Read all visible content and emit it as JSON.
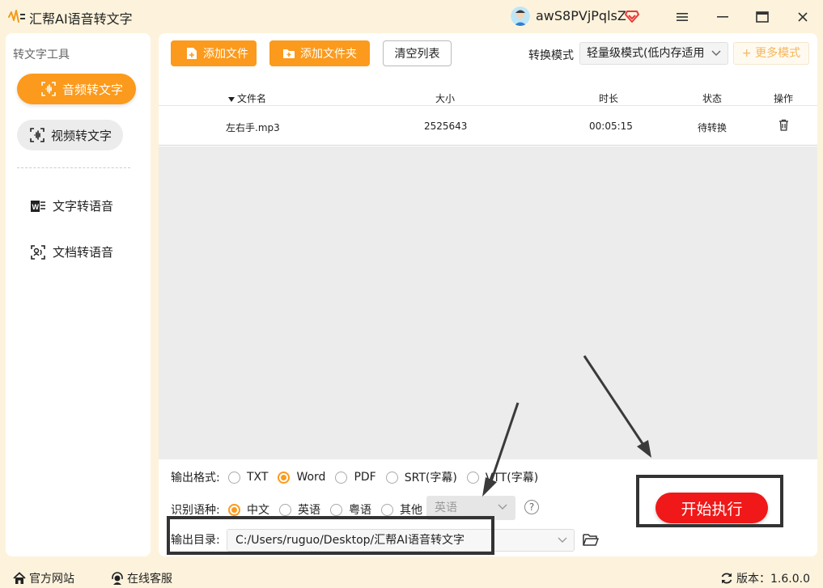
{
  "app": {
    "title": "汇帮AI语音转文字",
    "username": "awS8PVjPqlsZ"
  },
  "sidebar": {
    "title": "转文字工具",
    "items": [
      {
        "label": "音频转文字",
        "active": true,
        "icon": "audio-wave-icon"
      },
      {
        "label": "视频转文字",
        "active": false,
        "icon": "video-wave-icon"
      },
      {
        "label": "文字转语音",
        "active": false,
        "icon": "word-doc-icon"
      },
      {
        "label": "文档转语音",
        "active": false,
        "icon": "doc-voice-icon"
      }
    ]
  },
  "toolbar": {
    "add_file": "添加文件",
    "add_folder": "添加文件夹",
    "clear_list": "清空列表",
    "mode_label": "转换模式",
    "mode_value": "轻量级模式(低内存适用",
    "more_modes": "+ 更多模式"
  },
  "table": {
    "headers": {
      "name": "文件名",
      "size": "大小",
      "duration": "时长",
      "status": "状态",
      "action": "操作"
    },
    "rows": [
      {
        "name": "左右手.mp3",
        "size": "2525643",
        "duration": "00:05:15",
        "status": "待转换"
      }
    ]
  },
  "settings": {
    "format_label": "输出格式:",
    "formats": [
      {
        "label": "TXT",
        "selected": false
      },
      {
        "label": "Word",
        "selected": true
      },
      {
        "label": "PDF",
        "selected": false
      },
      {
        "label": "SRT(字幕)",
        "selected": false
      },
      {
        "label": "VTT(字幕)",
        "selected": false
      }
    ],
    "language_label": "识别语种:",
    "languages": [
      {
        "label": "中文",
        "selected": true
      },
      {
        "label": "英语",
        "selected": false
      },
      {
        "label": "粤语",
        "selected": false
      },
      {
        "label": "其他",
        "selected": false
      }
    ],
    "other_language_value": "英语",
    "help": "?",
    "output_label": "输出目录:",
    "output_path": "C:/Users/ruguo/Desktop/汇帮AI语音转文字",
    "start_button": "开始执行"
  },
  "footer": {
    "website": "官方网站",
    "service": "在线客服",
    "version": "版本：1.6.0.0"
  },
  "colors": {
    "accent": "#fb9a1c",
    "start": "#f01818",
    "background": "#fdf3dc"
  }
}
